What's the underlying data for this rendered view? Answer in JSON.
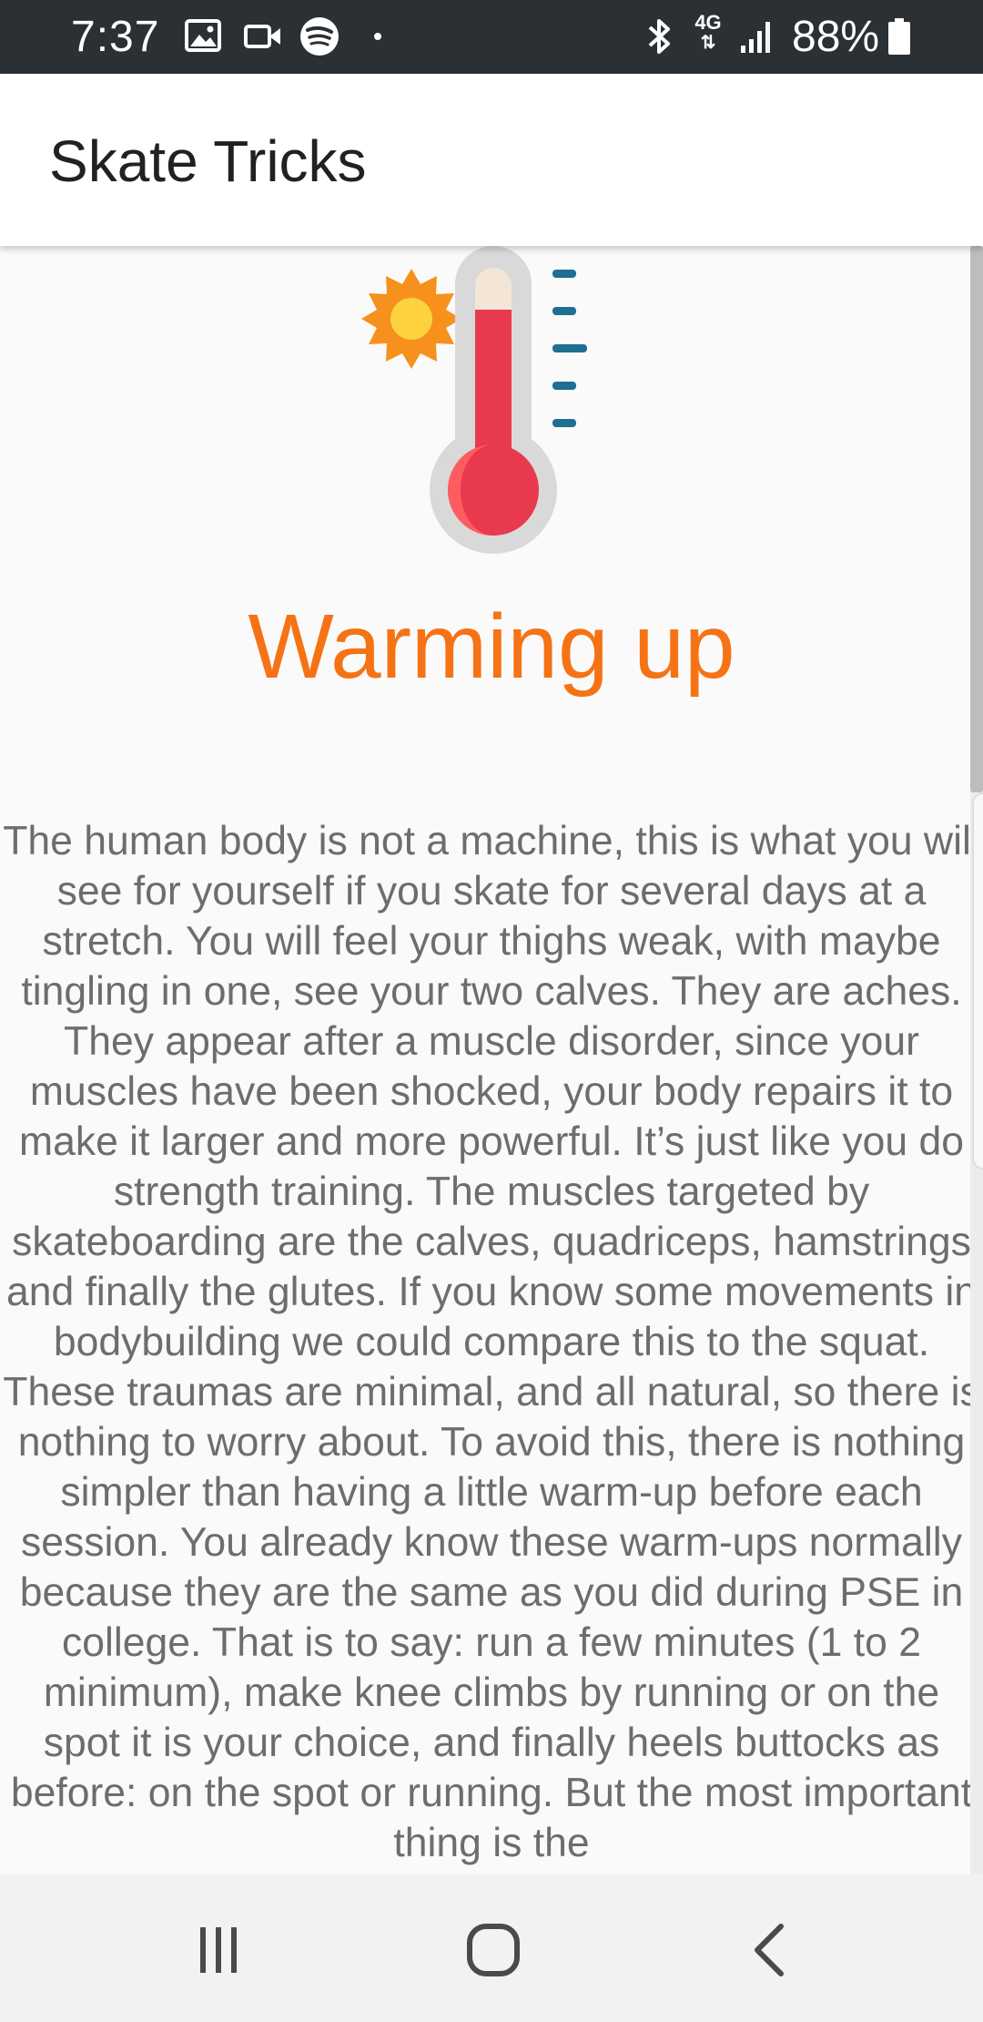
{
  "status_bar": {
    "time": "7:37",
    "battery": "88%",
    "network_type": "4G",
    "icons_left": [
      "gallery-icon",
      "video-camera-icon",
      "spotify-icon",
      "dot-icon"
    ],
    "icons_right": [
      "bluetooth-icon",
      "4g-icon",
      "signal-icon",
      "battery-icon"
    ]
  },
  "app_bar": {
    "title": "Skate Tricks"
  },
  "article": {
    "illustration": "thermometer-sun-icon",
    "title": "Warming up",
    "body": "The human body is not a machine, this is what you will see for yourself if you skate for several days at a stretch. You will feel your thighs weak, with maybe tingling in one, see your two calves. They are aches. They appear after a muscle disorder, since your muscles have been shocked, your body repairs it to make it larger and more powerful. It’s just like you do strength training. The muscles targeted by skateboarding are the calves, quadriceps, hamstrings and finally the glutes. If you know some movements in bodybuilding we could compare this to the squat. These traumas are minimal, and all natural, so there is nothing to worry about. To avoid this, there is nothing simpler than having a little warm-up before each session. You already know these warm-ups normally because they are the same as you did during PSE in college. That is to say: run a few minutes (1 to 2 minimum), make knee climbs by running or on the spot it is your choice, and finally heels buttocks as before: on the spot or running. But the most important thing is the"
  },
  "nav_bar": {
    "buttons": [
      "recent-apps-icon",
      "home-icon",
      "back-icon"
    ]
  },
  "colors": {
    "status_bar_bg": "#2b3035",
    "title_accent": "#f57315",
    "body_text": "#6d6d6d",
    "thermometer_red": "#e8394f",
    "sun_orange": "#f7911d",
    "sun_yellow": "#fcd23f",
    "tick_blue": "#1f6e93"
  }
}
